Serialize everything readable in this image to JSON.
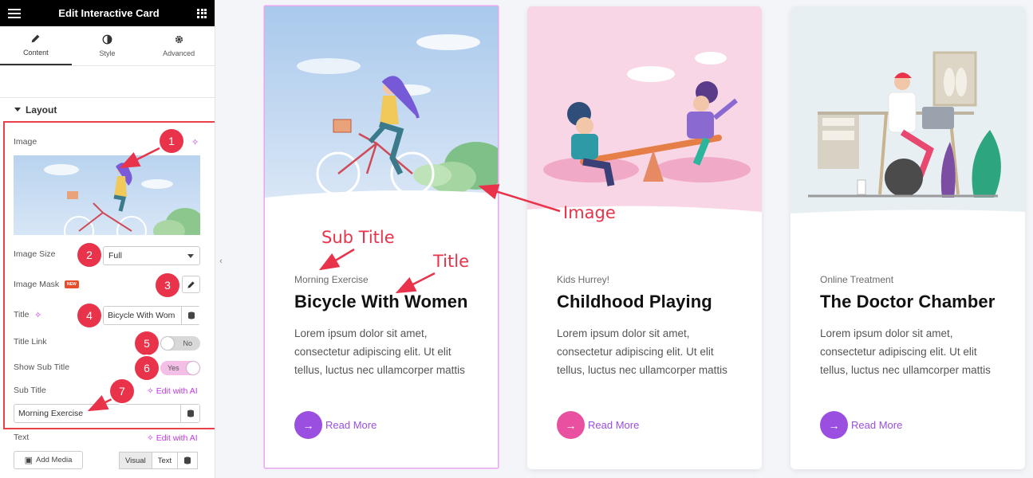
{
  "panel": {
    "header_title": "Edit Interactive Card",
    "tabs": [
      {
        "label": "Content",
        "icon": "pencil-icon"
      },
      {
        "label": "Style",
        "icon": "contrast-icon"
      },
      {
        "label": "Advanced",
        "icon": "gear-icon"
      }
    ],
    "section_title": "Layout",
    "image_label": "Image",
    "image_size_label": "Image Size",
    "image_size_value": "Full",
    "image_mask_label": "Image Mask",
    "new_badge": "NEW",
    "title_label": "Title",
    "title_value": "Bicycle With Wom",
    "title_link_label": "Title Link",
    "title_link_toggle": "No",
    "show_sub_title_label": "Show Sub Title",
    "show_sub_title_toggle": "Yes",
    "sub_title_label": "Sub Title",
    "sub_title_value": "Morning Exercise",
    "edit_with_ai": "Edit with AI",
    "text_label": "Text",
    "add_media": "Add Media",
    "editor_tabs": [
      "Visual",
      "Text"
    ]
  },
  "markers": [
    "1",
    "2",
    "3",
    "4",
    "5",
    "6",
    "7"
  ],
  "annotations": {
    "image": "Image",
    "sub_title": "Sub Title",
    "title": "Title"
  },
  "cards": [
    {
      "subtitle": "Morning Exercise",
      "title": "Bicycle With Women",
      "text": "Lorem ipsum dolor sit amet, consectetur adipiscing elit. Ut elit tellus, luctus nec ullamcorper mattis",
      "button": "Read More",
      "accent": "#9a4fe0",
      "art_bg": "#c9ddf2"
    },
    {
      "subtitle": "Kids Hurrey!",
      "title": "Childhood Playing",
      "text": "Lorem ipsum dolor sit amet, consectetur adipiscing elit. Ut elit tellus, luctus nec ullamcorper mattis",
      "button": "Read More",
      "accent": "#e9509f",
      "art_bg": "#f8d6e6"
    },
    {
      "subtitle": "Online Treatment",
      "title": "The Doctor Chamber",
      "text": "Lorem ipsum dolor sit amet, consectetur adipiscing elit. Ut elit tellus, luctus nec ullamcorper mattis",
      "button": "Read More",
      "accent": "#9a4fe0",
      "art_bg": "#e8eff2"
    }
  ],
  "colors": {
    "annotation_red": "#e8334a",
    "ai_purple": "#c036e8"
  }
}
